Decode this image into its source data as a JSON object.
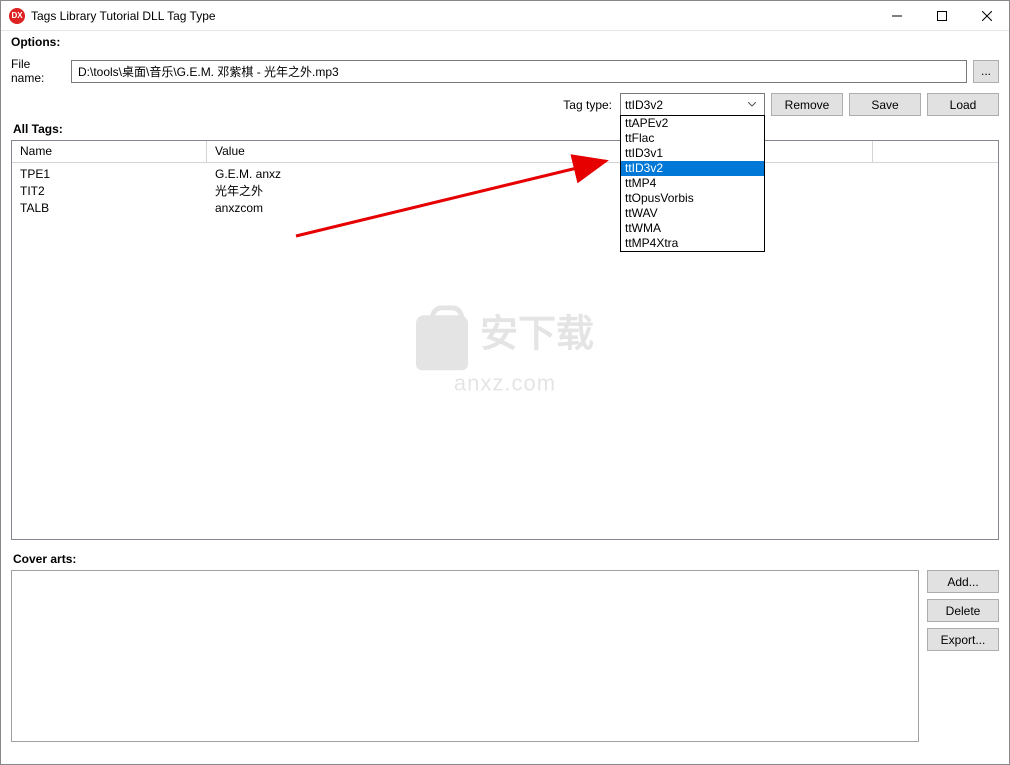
{
  "window": {
    "title": "Tags Library Tutorial DLL Tag Type"
  },
  "options": {
    "heading": "Options:",
    "file_label": "File name:",
    "file_value": "D:\\tools\\桌面\\音乐\\G.E.M. 邓紫棋 - 光年之外.mp3",
    "browse_label": "..."
  },
  "toolbar": {
    "tag_type_label": "Tag type:",
    "tag_type_selected": "ttID3v2",
    "dropdown_items": [
      "ttAPEv2",
      "ttFlac",
      "ttID3v1",
      "ttID3v2",
      "ttMP4",
      "ttOpusVorbis",
      "ttWAV",
      "ttWMA",
      "ttMP4Xtra"
    ],
    "dropdown_selected_index": 3,
    "remove_label": "Remove",
    "save_label": "Save",
    "load_label": "Load"
  },
  "tags": {
    "heading": "All Tags:",
    "columns": {
      "name": "Name",
      "value": "Value"
    },
    "rows": [
      {
        "name": "TPE1",
        "value": "G.E.M. anxz"
      },
      {
        "name": "TIT2",
        "value": "光年之外"
      },
      {
        "name": "TALB",
        "value": "anxzcom"
      }
    ]
  },
  "cover": {
    "heading": "Cover arts:",
    "add_label": "Add...",
    "delete_label": "Delete",
    "export_label": "Export..."
  },
  "watermark": {
    "line1": "安下载",
    "line2": "anxz.com"
  }
}
